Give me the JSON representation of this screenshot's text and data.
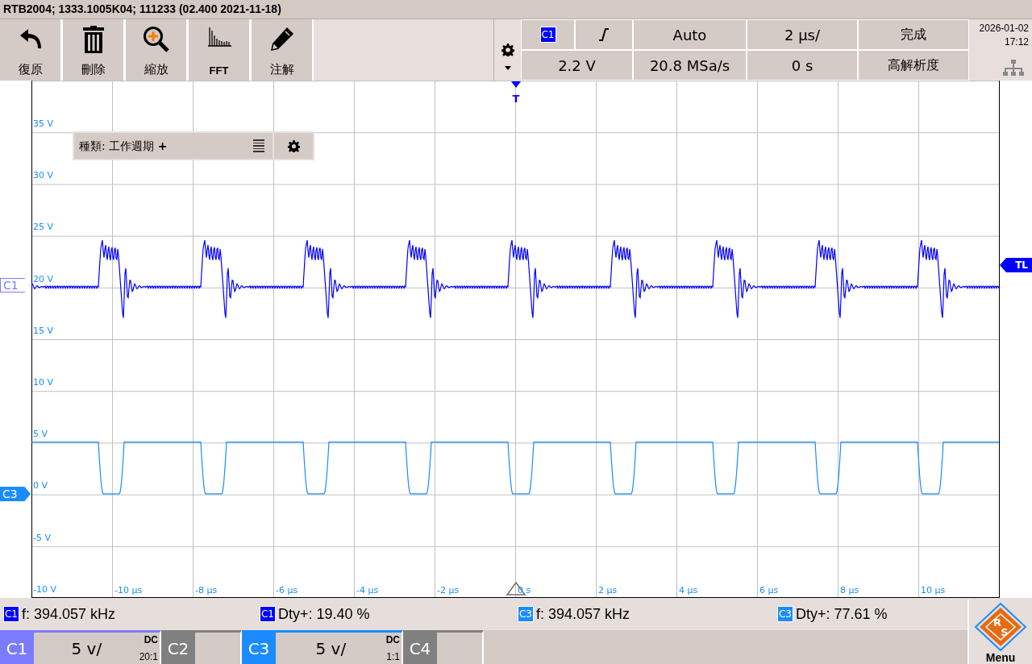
{
  "title": "RTB2004; 1333.1005K04; 111233 (02.400 2021-11-18)",
  "toolbar": [
    {
      "kind": "undo",
      "label": "復原"
    },
    {
      "kind": "delete",
      "label": "刪除"
    },
    {
      "kind": "zoom",
      "label": "縮放"
    },
    {
      "kind": "fft",
      "label": "FFT"
    },
    {
      "kind": "annotate",
      "label": "注解"
    }
  ],
  "trigger_panel": {
    "source": "C1",
    "mode": "Auto",
    "timebase": "2 µs/",
    "status": "完成",
    "level": "2.2 V",
    "sample_rate": "20.8 MSa/s",
    "position": "0 s",
    "acquisition": "高解析度"
  },
  "datetime": {
    "date": "2026-01-02",
    "time": "17:12"
  },
  "plot": {
    "y_labels": [
      "35 V",
      "30 V",
      "25 V",
      "20 V",
      "15 V",
      "10 V",
      "5 V",
      "0 V",
      "-5 V",
      "-10 V"
    ],
    "x_labels": [
      "-10 µs",
      "-8 µs",
      "-6 µs",
      "-4 µs",
      "-2 µs",
      "0 s",
      "2 µs",
      "4 µs",
      "6 µs",
      "8 µs",
      "10 µs"
    ],
    "trigger_marker": "T",
    "trigger_level_marker": "TL",
    "channel_markers": [
      {
        "label": "C1",
        "color": "#7b7bff"
      },
      {
        "label": "C3",
        "color": "#1a8cff"
      }
    ]
  },
  "measurement_popup": {
    "label": "種類: 工作週期 **+**"
  },
  "measurements": [
    {
      "channel": "C1",
      "color": "#0000ff",
      "text": "f: 394.057 kHz"
    },
    {
      "channel": "C1",
      "color": "#0000ff",
      "text": "Dty+: 19.40 %"
    },
    {
      "channel": "C3",
      "color": "#1a8cff",
      "text": "f: 394.057 kHz"
    },
    {
      "channel": "C3",
      "color": "#1a8cff",
      "text": "Dty+: 77.61 %"
    }
  ],
  "channels": [
    {
      "label": "C1",
      "on": true,
      "color": "#7b7bff",
      "scale": "5 v/",
      "coupling": "DC",
      "ratio": "20:1"
    },
    {
      "label": "C2",
      "on": false,
      "color": "#808080"
    },
    {
      "label": "C3",
      "on": true,
      "color": "#1a8cff",
      "scale": "5 v/",
      "coupling": "DC",
      "ratio": "1:1"
    },
    {
      "label": "C4",
      "on": false,
      "color": "#808080"
    }
  ],
  "menu": {
    "logo_letters": [
      "R",
      "S"
    ],
    "label": "Menu"
  }
}
